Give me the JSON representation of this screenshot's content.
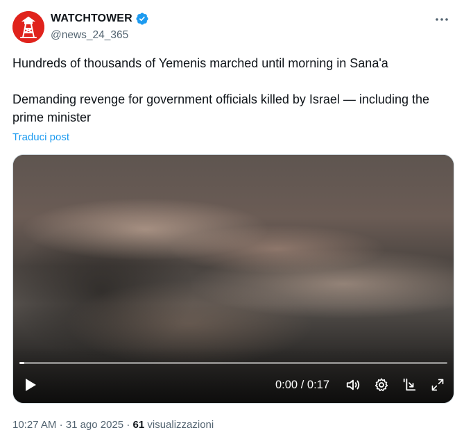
{
  "author": {
    "display_name": "WATCHTOWER",
    "handle": "@news_24_365",
    "verified": true,
    "avatar_icon": "watchtower-logo-icon"
  },
  "post": {
    "line1": "Hundreds of thousands of Yemenis marched until morning in Sana'a",
    "line2": "Demanding revenge for government officials killed by Israel — including the prime minister",
    "translate_label": "Traduci post"
  },
  "video": {
    "current_time": "0:00",
    "separator": "/",
    "duration": "0:17",
    "progress": 0.0,
    "icons": [
      "play-icon",
      "volume-icon",
      "settings-icon",
      "dock-icon",
      "fullscreen-icon"
    ]
  },
  "meta": {
    "time": "10:27 AM",
    "date": "31 ago 2025",
    "views_count": "61",
    "views_label": "visualizzazioni"
  },
  "colors": {
    "brand_red": "#e0231c",
    "link_blue": "#1d9bf0",
    "verified_blue": "#1d9bf0",
    "secondary_text": "#536471"
  }
}
